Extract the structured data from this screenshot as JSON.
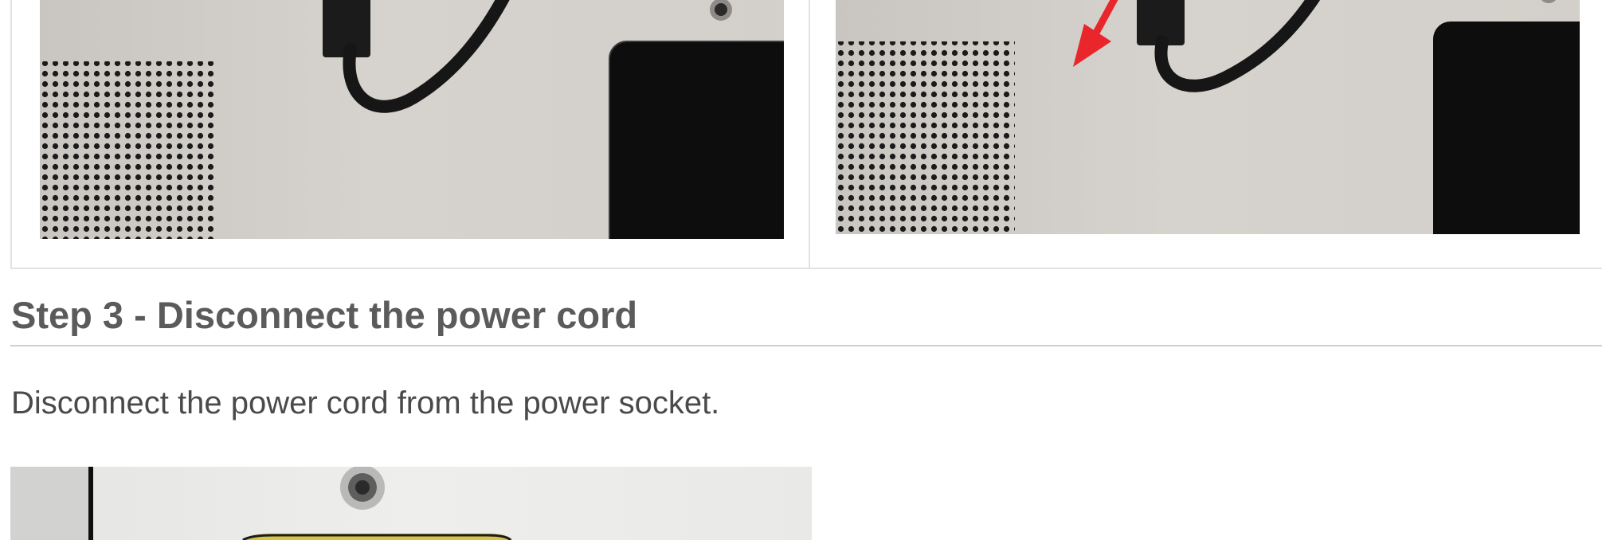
{
  "step": {
    "title": "Step 3 - Disconnect the power cord",
    "description": "Disconnect the power cord from the power socket."
  },
  "colors": {
    "heading": "#5b5b5b",
    "text": "#4a4a4a",
    "border": "#dfe4e3",
    "arrow": "#e8262b"
  },
  "icons": {
    "annotation": "red-arrow-icon"
  }
}
